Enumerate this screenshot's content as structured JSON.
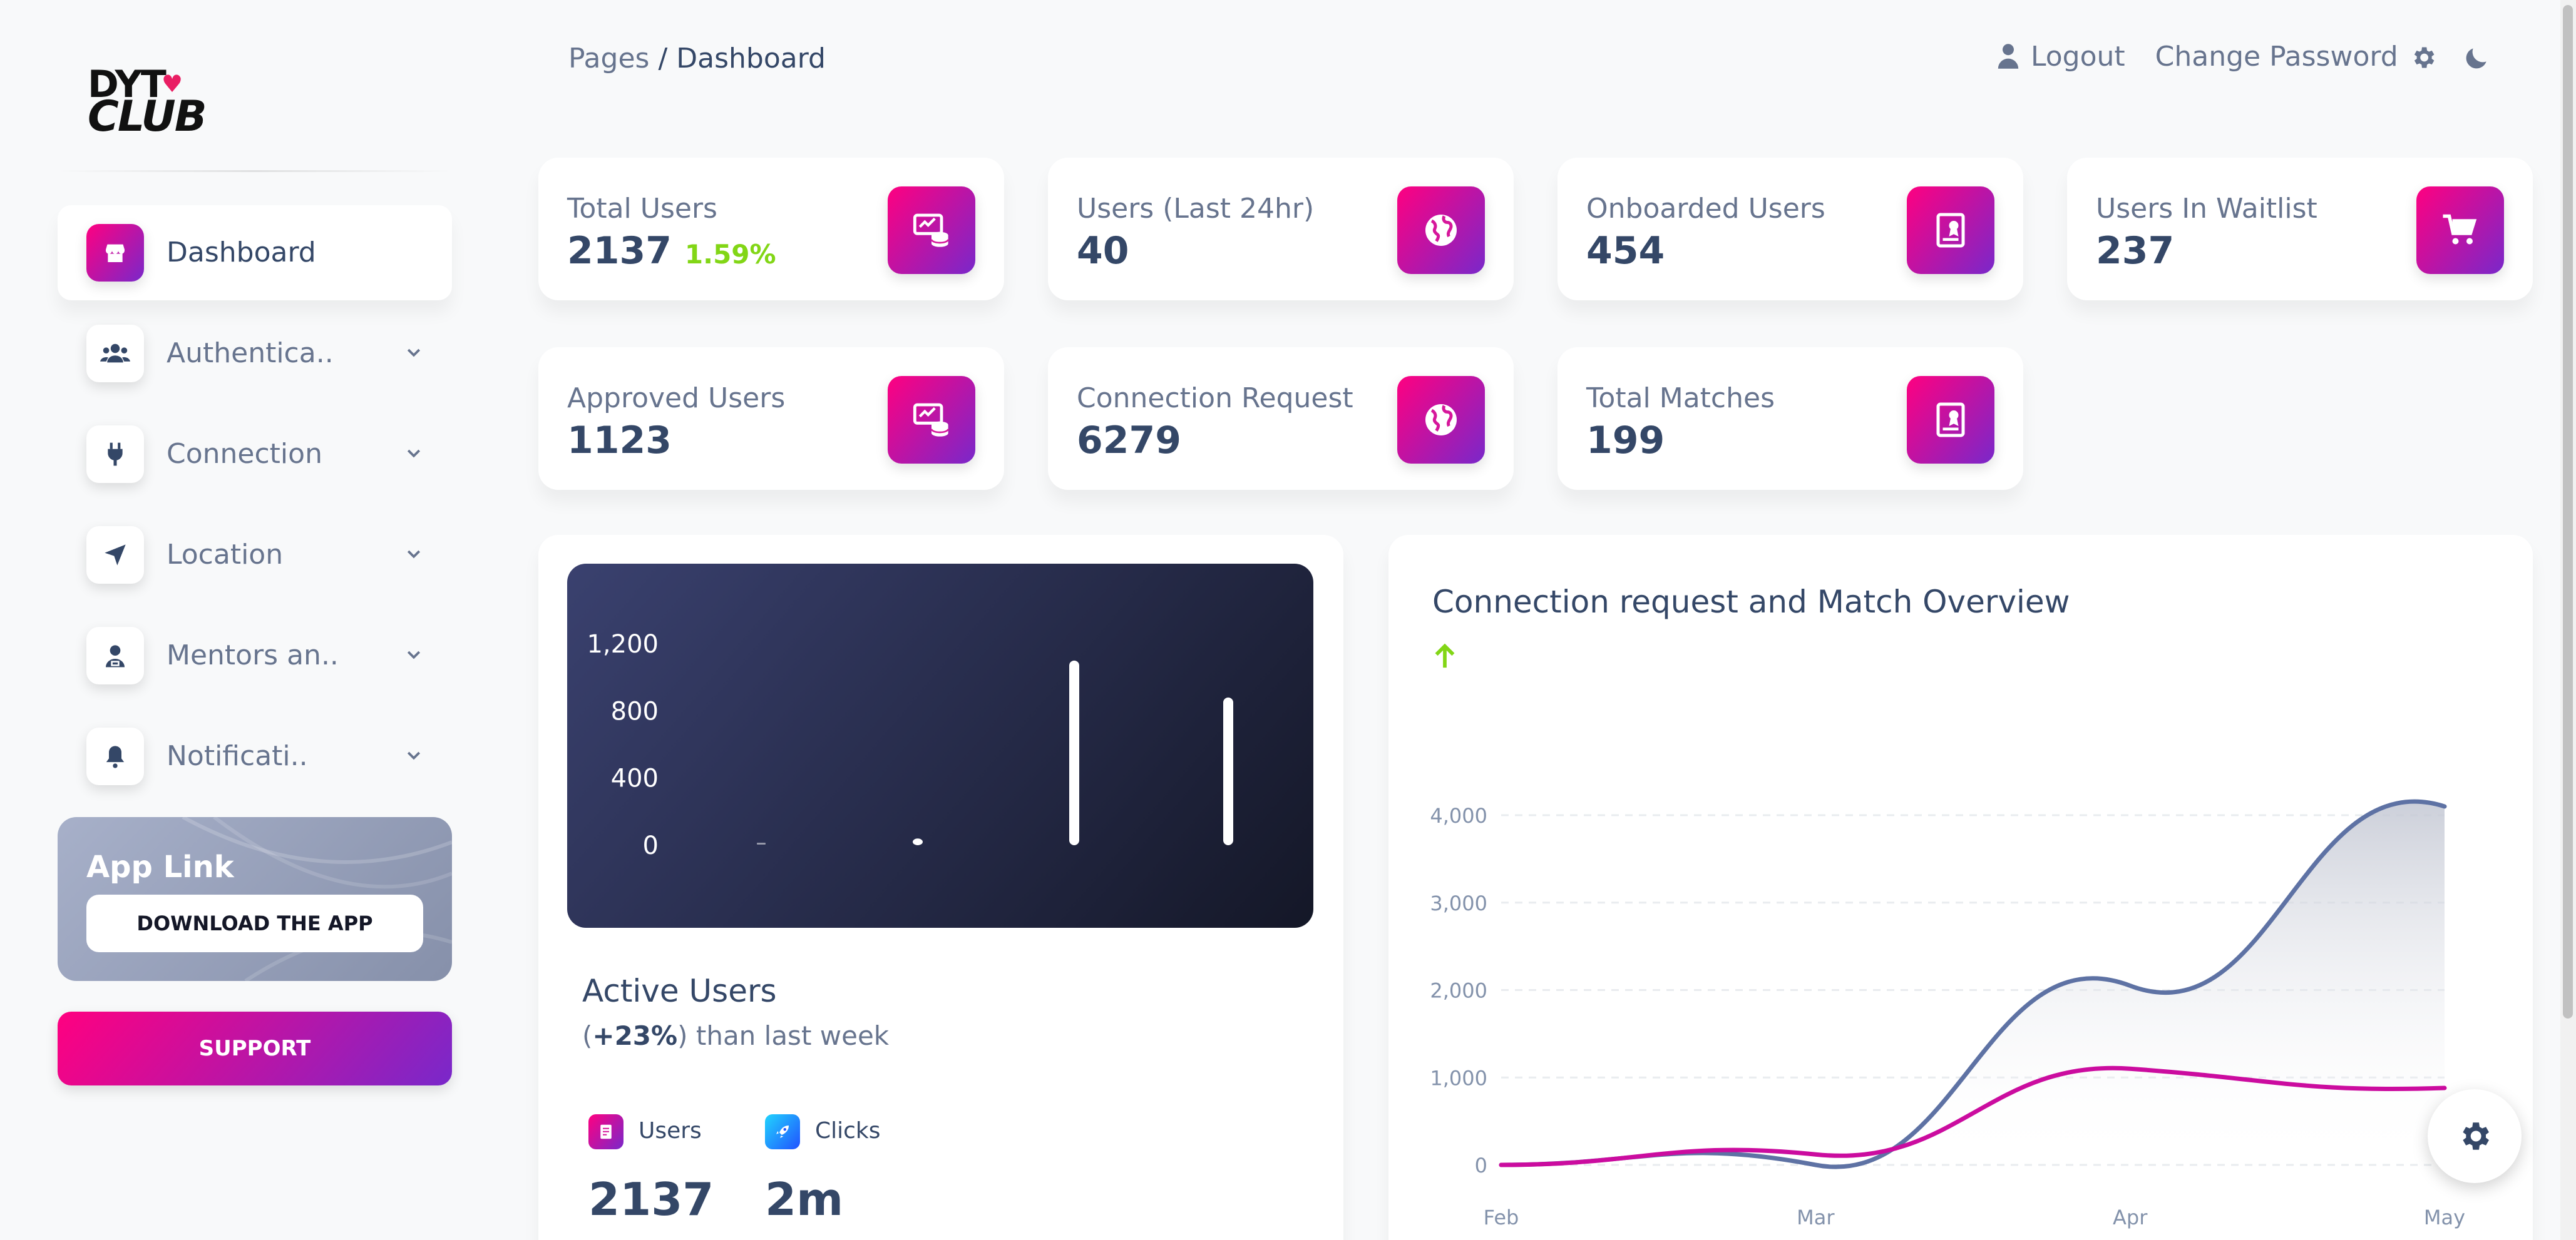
{
  "logo": {
    "line1": "DYT",
    "line2": "CLUB"
  },
  "sidebar": {
    "items": [
      {
        "label": "Dashboard",
        "icon": "shop-icon"
      },
      {
        "label": "Authentica..",
        "icon": "users-icon"
      },
      {
        "label": "Connection",
        "icon": "plug-icon"
      },
      {
        "label": "Location",
        "icon": "location-arrow-icon"
      },
      {
        "label": "Mentors an..",
        "icon": "user-tie-icon"
      },
      {
        "label": "Notificati..",
        "icon": "bell-icon"
      }
    ],
    "applink": {
      "title": "App Link",
      "button": "DOWNLOAD THE APP"
    },
    "support": "SUPPORT"
  },
  "breadcrumb": {
    "root": "Pages",
    "separator": " / ",
    "current": "Dashboard"
  },
  "topnav": {
    "logout": "Logout",
    "change_password": "Change Password"
  },
  "stats": [
    {
      "label": "Total Users",
      "value": "2137",
      "change": "1.59%",
      "icon": "money-coins-icon"
    },
    {
      "label": "Users (Last 24hr)",
      "value": "40",
      "icon": "world-icon"
    },
    {
      "label": "Onboarded Users",
      "value": "454",
      "icon": "paper-diploma-icon"
    },
    {
      "label": "Users In Waitlist",
      "value": "237",
      "icon": "cart-icon"
    },
    {
      "label": "Approved Users",
      "value": "1123",
      "icon": "money-coins-icon"
    },
    {
      "label": "Connection Request",
      "value": "6279",
      "icon": "world-icon"
    },
    {
      "label": "Total Matches",
      "value": "199",
      "icon": "paper-diploma-icon"
    }
  ],
  "active_users": {
    "title": "Active Users",
    "sub_open": "(",
    "sub_bold": "+23%",
    "sub_rest": ") than last week",
    "mini": [
      {
        "label": "Users",
        "value": "2137",
        "color": "#cb0c9f",
        "icon": "document-icon"
      },
      {
        "label": "Clicks",
        "value": "2m",
        "color": "#2152ff",
        "icon": "rocket-icon"
      }
    ]
  },
  "colors": {
    "primary_start": "#7928ca",
    "primary_end": "#ff0080",
    "success": "#82d616",
    "line1": "#5e72a4",
    "line2": "#cb0c9f"
  },
  "chart_data": [
    {
      "type": "bar",
      "categories": [
        "",
        "",
        "",
        ""
      ],
      "values": [
        0,
        40,
        1100,
        880
      ],
      "yticks": [
        "0",
        "400",
        "800",
        "1,200"
      ],
      "ylim": [
        0,
        1400
      ],
      "grid": false
    },
    {
      "type": "line",
      "title": "Connection request and Match Overview",
      "x": [
        "Feb",
        "Mar",
        "Apr",
        "May"
      ],
      "yticks": [
        "0",
        "1,000",
        "2,000",
        "3,000",
        "4,000"
      ],
      "ylim": [
        0,
        4000
      ],
      "grid": true,
      "series": [
        {
          "values": [
            0,
            0,
            2050,
            4100
          ],
          "color": "#5e72a4",
          "fill": true
        },
        {
          "values": [
            0,
            120,
            1100,
            880
          ],
          "color": "#cb0c9f",
          "fill": false
        }
      ]
    }
  ]
}
